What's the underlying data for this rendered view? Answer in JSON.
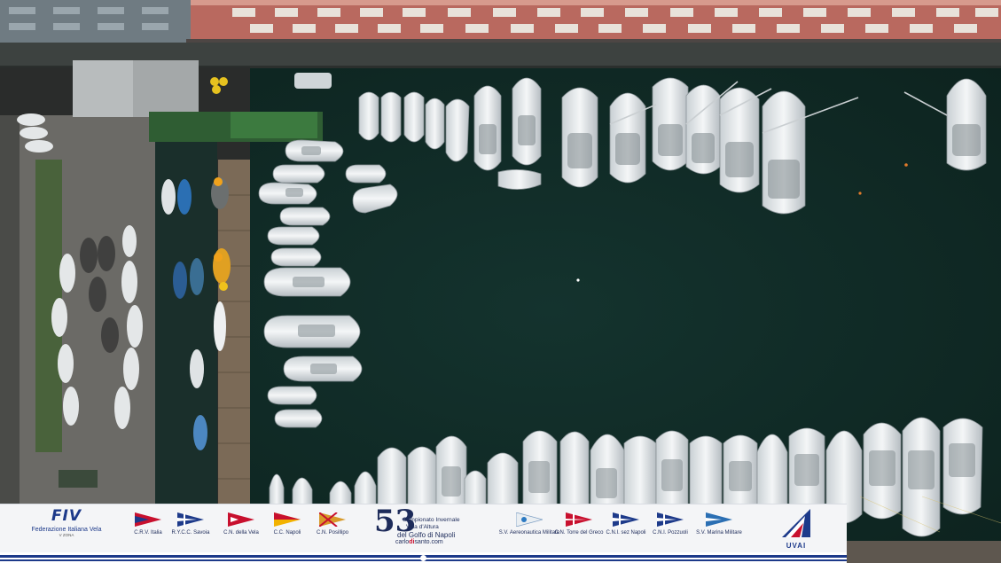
{
  "sponsors": {
    "fiv": {
      "mark": "FIV",
      "name": "Federazione Italiana Vela",
      "tag": "V ZONA"
    },
    "clubs": [
      {
        "label": "C.R.V. Italia"
      },
      {
        "label": "R.Y.C.C. Savoia"
      },
      {
        "label": "C.N. della Vela"
      },
      {
        "label": "C.C. Napoli"
      },
      {
        "label": "C.N. Posillipo"
      },
      {
        "label": "S.V. Aereonautica Militare"
      },
      {
        "label": "C.N. Torre del Greco"
      },
      {
        "label": "C.N.I. sez Napoli"
      },
      {
        "label": "C.N.I. Pozzuoli"
      },
      {
        "label": "S.V. Marina Militare"
      }
    ],
    "championship": {
      "number": "53",
      "line1": "Campionato Invernale",
      "line2": "Vela d'Altura",
      "line3": "del Golfo di Napoli",
      "url_prefix": "carlo",
      "url_bold": "di",
      "url_suffix": "santo.com"
    },
    "uvai": {
      "label": "UVAI"
    }
  },
  "colors": {
    "water": "#0f2a26",
    "navy": "#1d3a8a",
    "red": "#c8102e",
    "building": "#b9695f"
  }
}
